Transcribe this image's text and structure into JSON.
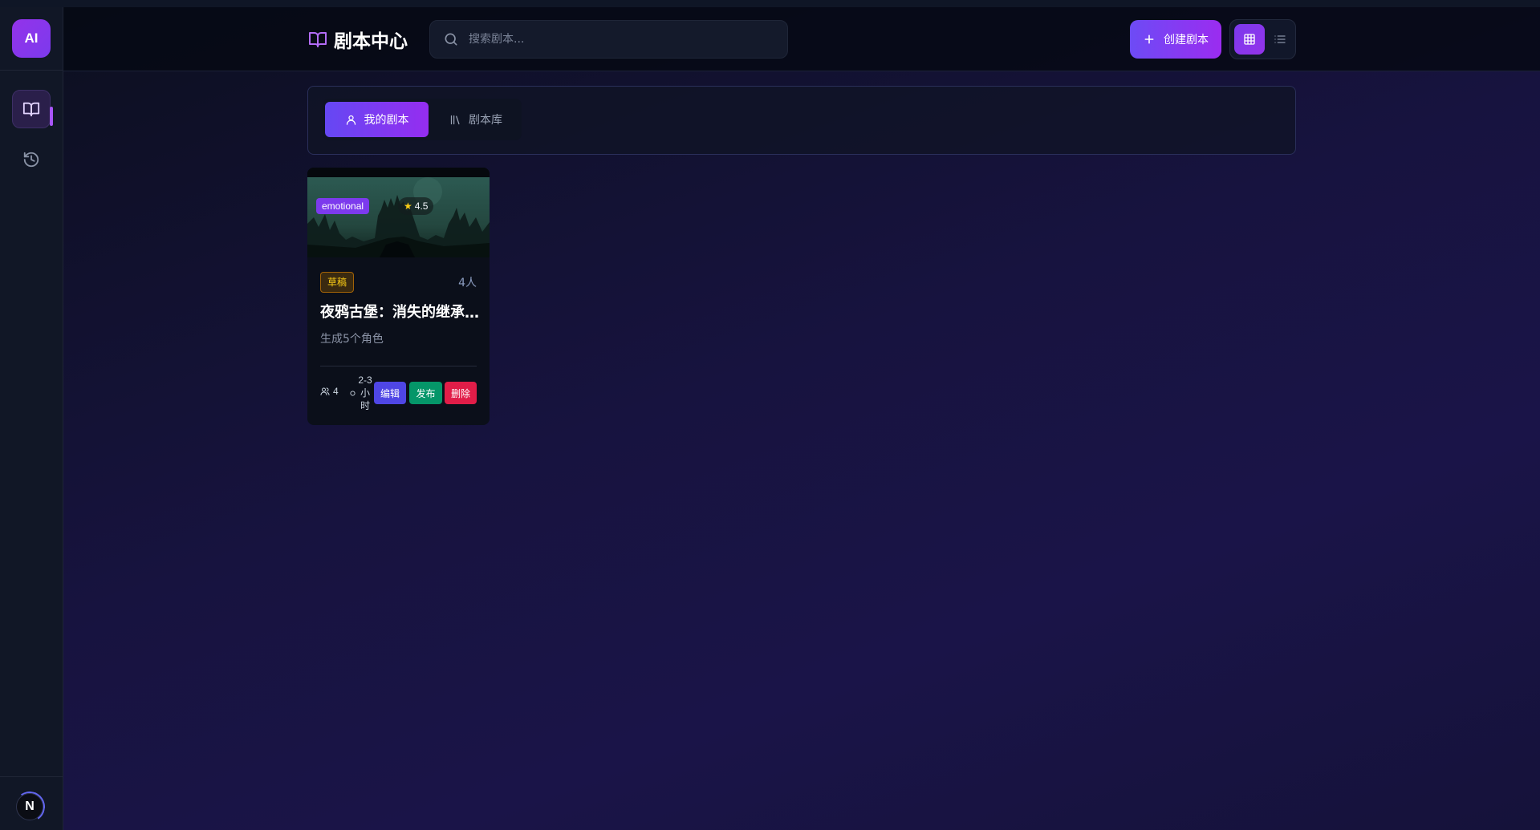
{
  "sidebar": {
    "logo_text": "AI",
    "items": [
      {
        "name": "scripts",
        "icon": "book-open-icon",
        "active": true
      },
      {
        "name": "history",
        "icon": "history-icon",
        "active": false
      }
    ],
    "avatar_text": "N"
  },
  "header": {
    "title": "剧本中心",
    "title_icon": "book-open-icon",
    "search_placeholder": "搜索剧本...",
    "create_label": "创建剧本",
    "view_mode": "grid"
  },
  "tabs": [
    {
      "label": "我的剧本",
      "icon": "user-icon",
      "active": true
    },
    {
      "label": "剧本库",
      "icon": "library-icon",
      "active": false
    }
  ],
  "scripts": [
    {
      "genre": "emotional",
      "rating": "4.5",
      "status": "草稿",
      "players_label": "4人",
      "title": "夜鸦古堡：消失的继承人",
      "description": "生成5个角色",
      "players": "4",
      "duration": "2-3小时",
      "actions": {
        "edit": "编辑",
        "publish": "发布",
        "delete": "删除"
      }
    }
  ],
  "colors": {
    "accent": "#8b5cf6",
    "edit": "#4f46e5",
    "publish": "#059669",
    "delete": "#e11d48",
    "status_draft": "#facc15"
  }
}
